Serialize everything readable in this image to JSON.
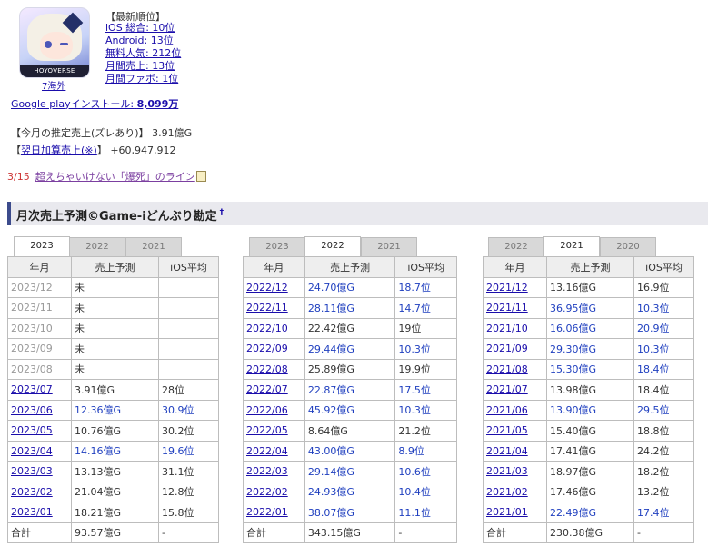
{
  "app": {
    "icon_band_text": "HOYOVERSE",
    "region_label": "7海外"
  },
  "ranking": {
    "heading": "【最新順位】",
    "items": [
      "iOS 総合: 10位",
      "Android: 13位",
      "無料人気: 212位",
      "月間売上: 13位",
      "月間ファボ: 1位"
    ]
  },
  "google_play": {
    "label": "Google playインストール:",
    "value": "8,099万"
  },
  "estimate": {
    "label": "【今月の推定売上(ズレあり)】",
    "value": "3.91億G"
  },
  "next_day": {
    "open": "【",
    "link": "翌日加算売上(※)",
    "close": "】",
    "value": "+60,947,912"
  },
  "danger": {
    "date": "3/15",
    "text": "超えちゃいけない「爆死」のライン"
  },
  "section": {
    "title": "月次売上予測©Game-iどんぶり勘定",
    "marker": "†"
  },
  "columns": {
    "month": "年月",
    "sales": "売上予測",
    "ios": "iOS平均"
  },
  "panels": [
    {
      "tabs": [
        "2023",
        "2022",
        "2021"
      ],
      "active": 0,
      "rows": [
        {
          "m": "2023/12",
          "v": "未",
          "r": "",
          "future": true
        },
        {
          "m": "2023/11",
          "v": "未",
          "r": "",
          "future": true
        },
        {
          "m": "2023/10",
          "v": "未",
          "r": "",
          "future": true
        },
        {
          "m": "2023/09",
          "v": "未",
          "r": "",
          "future": true
        },
        {
          "m": "2023/08",
          "v": "未",
          "r": "",
          "future": true
        },
        {
          "m": "2023/07",
          "v": "3.91億G",
          "r": "28位",
          "blue": false
        },
        {
          "m": "2023/06",
          "v": "12.36億G",
          "r": "30.9位",
          "blue": true
        },
        {
          "m": "2023/05",
          "v": "10.76億G",
          "r": "30.2位",
          "blue": false
        },
        {
          "m": "2023/04",
          "v": "14.16億G",
          "r": "19.6位",
          "blue": true
        },
        {
          "m": "2023/03",
          "v": "13.13億G",
          "r": "31.1位",
          "blue": false
        },
        {
          "m": "2023/02",
          "v": "21.04億G",
          "r": "12.8位",
          "blue": false
        },
        {
          "m": "2023/01",
          "v": "18.21億G",
          "r": "15.8位",
          "blue": false
        }
      ],
      "total": {
        "label": "合計",
        "v": "93.57億G",
        "r": "-"
      }
    },
    {
      "tabs": [
        "2023",
        "2022",
        "2021"
      ],
      "active": 1,
      "rows": [
        {
          "m": "2022/12",
          "v": "24.70億G",
          "r": "18.7位",
          "blue": true
        },
        {
          "m": "2022/11",
          "v": "28.11億G",
          "r": "14.7位",
          "blue": true
        },
        {
          "m": "2022/10",
          "v": "22.42億G",
          "r": "19位",
          "blue": false
        },
        {
          "m": "2022/09",
          "v": "29.44億G",
          "r": "10.3位",
          "blue": true
        },
        {
          "m": "2022/08",
          "v": "25.89億G",
          "r": "19.9位",
          "blue": false
        },
        {
          "m": "2022/07",
          "v": "22.87億G",
          "r": "17.5位",
          "blue": true
        },
        {
          "m": "2022/06",
          "v": "45.92億G",
          "r": "10.3位",
          "blue": true
        },
        {
          "m": "2022/05",
          "v": "8.64億G",
          "r": "21.2位",
          "blue": false
        },
        {
          "m": "2022/04",
          "v": "43.00億G",
          "r": "8.9位",
          "blue": true
        },
        {
          "m": "2022/03",
          "v": "29.14億G",
          "r": "10.6位",
          "blue": true
        },
        {
          "m": "2022/02",
          "v": "24.93億G",
          "r": "10.4位",
          "blue": true
        },
        {
          "m": "2022/01",
          "v": "38.07億G",
          "r": "11.1位",
          "blue": true
        }
      ],
      "total": {
        "label": "合計",
        "v": "343.15億G",
        "r": "-"
      }
    },
    {
      "tabs": [
        "2022",
        "2021",
        "2020"
      ],
      "active": 1,
      "rows": [
        {
          "m": "2021/12",
          "v": "13.16億G",
          "r": "16.9位",
          "blue": false
        },
        {
          "m": "2021/11",
          "v": "36.95億G",
          "r": "10.3位",
          "blue": true
        },
        {
          "m": "2021/10",
          "v": "16.06億G",
          "r": "20.9位",
          "blue": true
        },
        {
          "m": "2021/09",
          "v": "29.30億G",
          "r": "10.3位",
          "blue": true
        },
        {
          "m": "2021/08",
          "v": "15.30億G",
          "r": "18.4位",
          "blue": true
        },
        {
          "m": "2021/07",
          "v": "13.98億G",
          "r": "18.4位",
          "blue": false
        },
        {
          "m": "2021/06",
          "v": "13.90億G",
          "r": "29.5位",
          "blue": true
        },
        {
          "m": "2021/05",
          "v": "15.40億G",
          "r": "18.8位",
          "blue": false
        },
        {
          "m": "2021/04",
          "v": "17.41億G",
          "r": "24.2位",
          "blue": false
        },
        {
          "m": "2021/03",
          "v": "18.97億G",
          "r": "18.2位",
          "blue": false
        },
        {
          "m": "2021/02",
          "v": "17.46億G",
          "r": "13.2位",
          "blue": false
        },
        {
          "m": "2021/01",
          "v": "22.49億G",
          "r": "17.4位",
          "blue": true
        }
      ],
      "total": {
        "label": "合計",
        "v": "230.38億G",
        "r": "-"
      }
    }
  ]
}
